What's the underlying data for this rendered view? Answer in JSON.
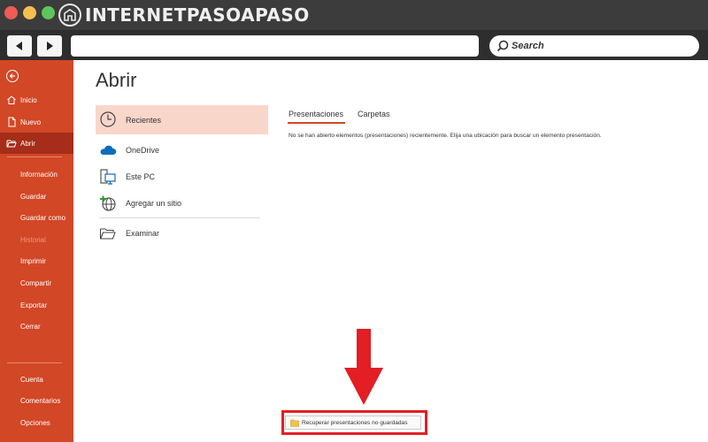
{
  "window": {
    "watermark_logo": "INTERNETPASOAPASO",
    "search_placeholder": "Search"
  },
  "sidebar": {
    "top_items": [
      {
        "label": "Inicio",
        "icon": "home-icon"
      },
      {
        "label": "Nuevo",
        "icon": "new-file-icon"
      },
      {
        "label": "Abrir",
        "icon": "open-folder-icon",
        "active": true
      }
    ],
    "middle_items": [
      {
        "label": "Información"
      },
      {
        "label": "Guardar"
      },
      {
        "label": "Guardar como"
      },
      {
        "label": "Historial",
        "disabled": true
      },
      {
        "label": "Imprimir"
      },
      {
        "label": "Compartir"
      },
      {
        "label": "Exportar"
      },
      {
        "label": "Cerrar"
      }
    ],
    "bottom_items": [
      {
        "label": "Cuenta"
      },
      {
        "label": "Comentarios"
      },
      {
        "label": "Opciones"
      }
    ]
  },
  "main": {
    "title": "Abrir",
    "locations": [
      {
        "label": "Recientes",
        "icon": "clock-icon",
        "selected": true
      },
      {
        "label": "OneDrive",
        "icon": "cloud-icon"
      },
      {
        "label": "Este PC",
        "icon": "computer-icon"
      },
      {
        "label": "Agregar un sitio",
        "icon": "globe-add-icon"
      },
      {
        "label": "Examinar",
        "icon": "folder-icon"
      }
    ],
    "tabs": [
      {
        "label": "Presentaciones",
        "active": true
      },
      {
        "label": "Carpetas"
      }
    ],
    "empty_message": "No se han abierto elementos (presentaciones) recientemente. Elija una ubicación para buscar un elemento presentación.",
    "recover_button": "Recuperar presentaciones no guardadas"
  },
  "colors": {
    "sidebar": "#d24726",
    "sidebar_active": "#a52d19",
    "selected_location": "#f9d6ca",
    "highlight_red": "#e31e24"
  }
}
